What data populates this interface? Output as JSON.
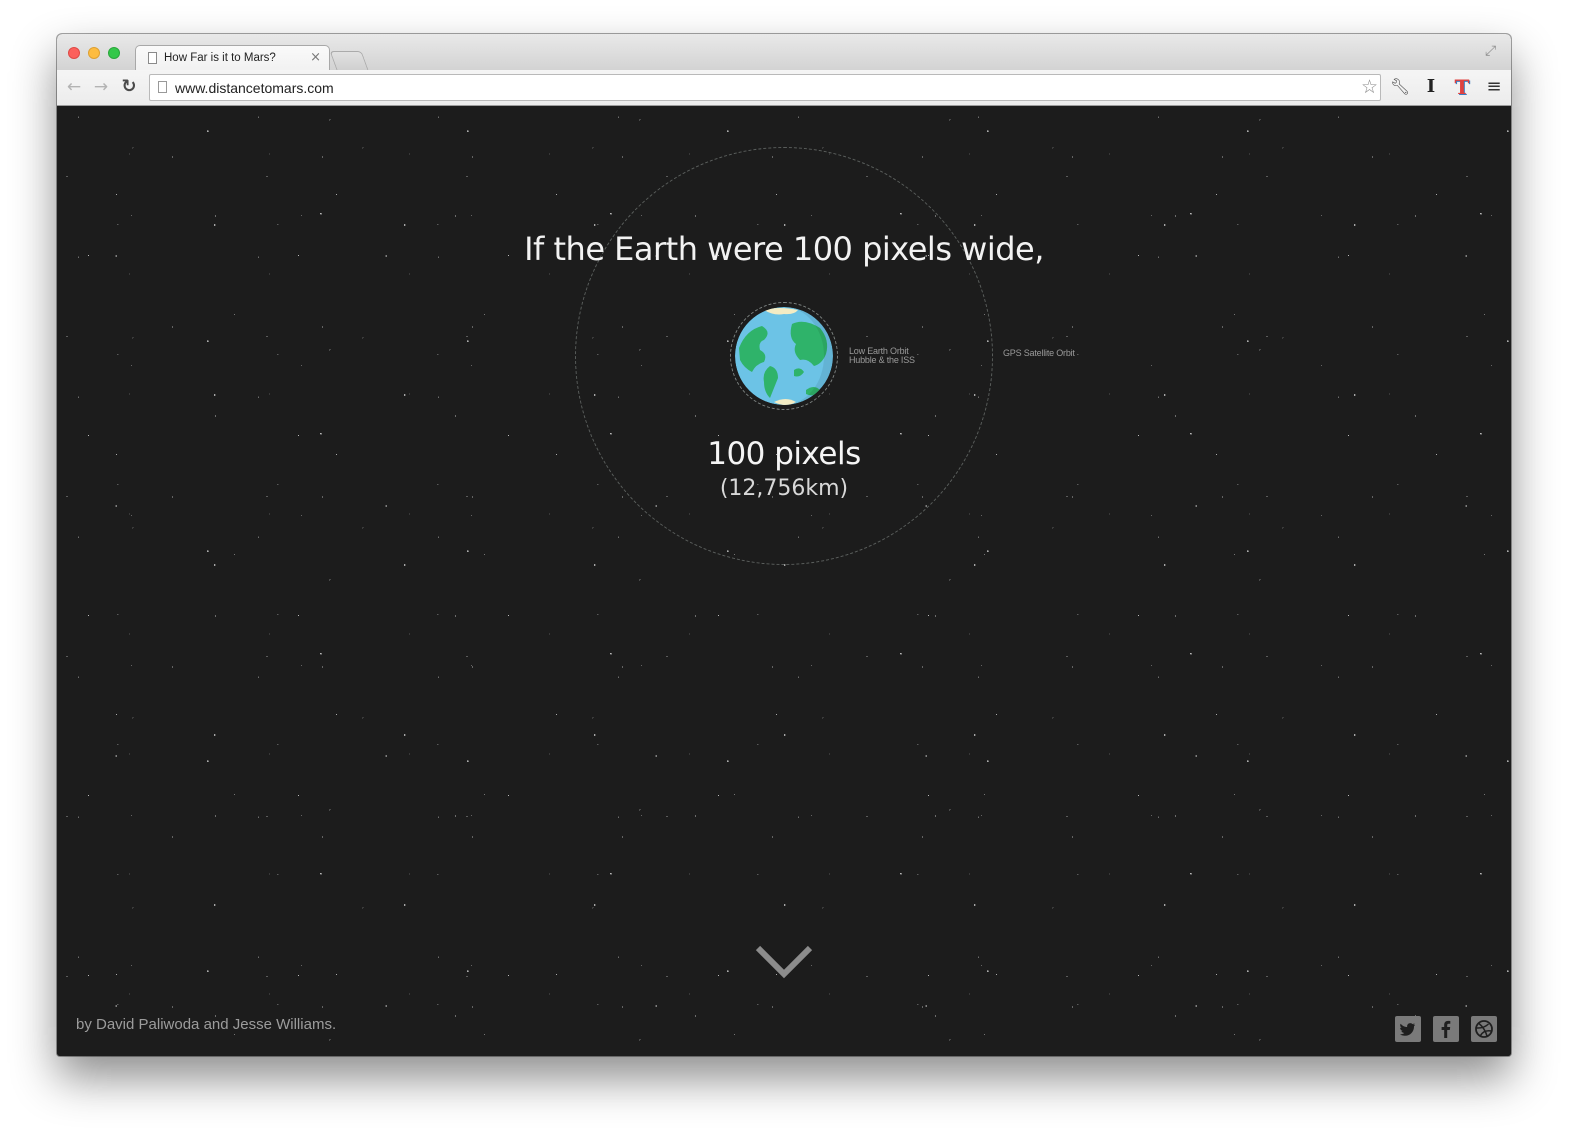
{
  "browser": {
    "tab_title": "How Far is it to Mars?",
    "tab_close": "×",
    "url": "www.distancetomars.com"
  },
  "page": {
    "headline": "If the Earth were 100 pixels wide,",
    "leo_label_line1": "Low Earth Orbit",
    "leo_label_line2": "Hubble & the ISS",
    "gps_label": "GPS Satellite Orbit",
    "size_main": "100 pixels",
    "size_km": "(12,756km)",
    "credits": "by David Paliwoda and Jesse Williams."
  },
  "icons": {
    "back": "arrow-left",
    "forward": "arrow-right",
    "reload": "reload",
    "bookmark": "star",
    "extensions": [
      "wrench",
      "ibeam",
      "tee"
    ],
    "menu": "hamburger",
    "scroll": "chevron-down",
    "social": [
      "twitter",
      "facebook",
      "dribbble"
    ]
  },
  "colors": {
    "background": "#1c1c1c",
    "ocean": "#6cc3e6",
    "land": "#2fb36a",
    "ice": "#f3ecc4",
    "chevron": "#8c8c8c"
  }
}
